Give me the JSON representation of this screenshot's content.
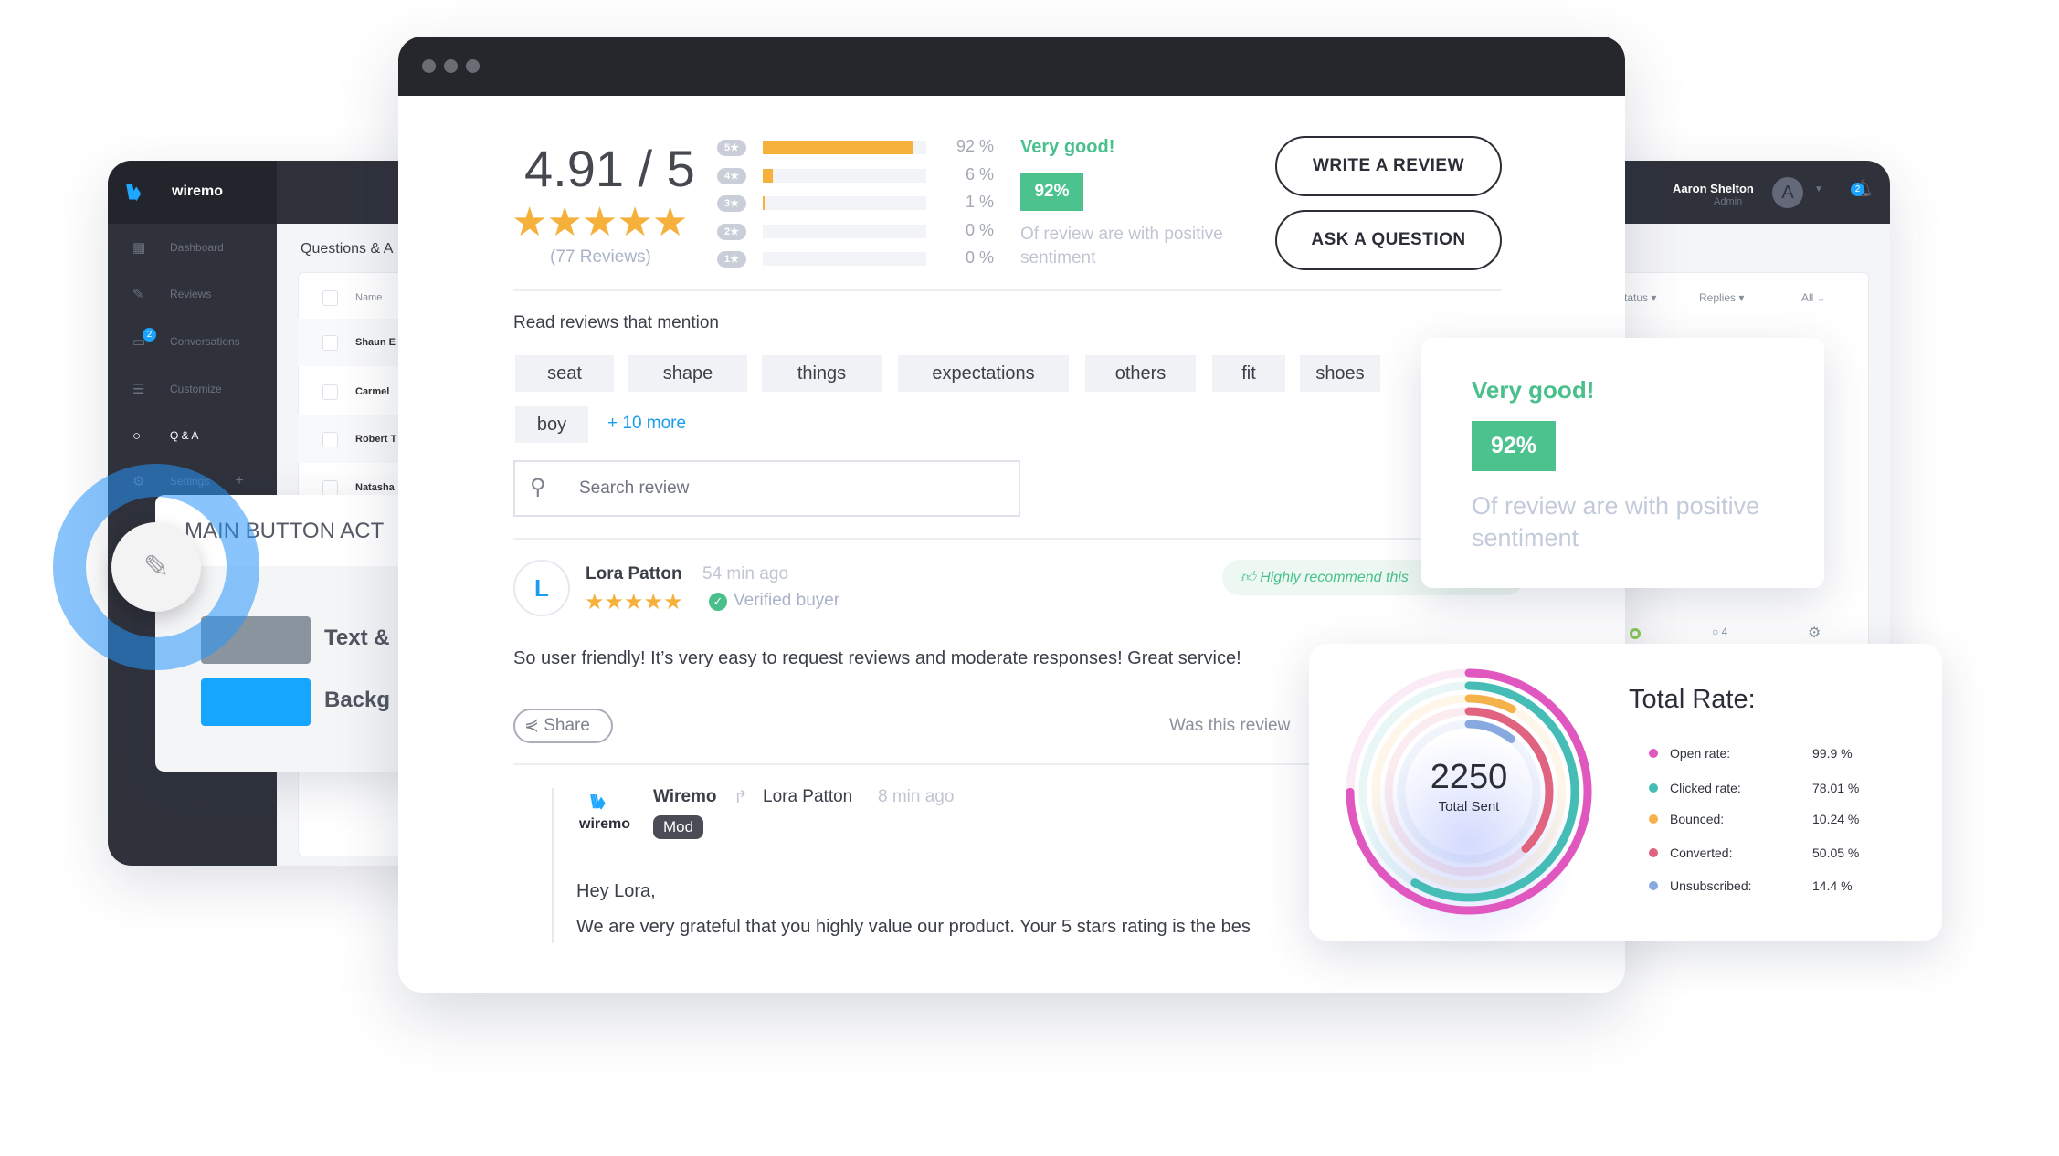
{
  "dashboard": {
    "brand": "wiremo",
    "sidebar": [
      {
        "label": "Dashboard",
        "icon": "grid-icon"
      },
      {
        "label": "Reviews",
        "icon": "edit-icon"
      },
      {
        "label": "Conversations",
        "icon": "chat-icon",
        "badge": "2"
      },
      {
        "label": "Customize",
        "icon": "sliders-icon"
      },
      {
        "label": "Q & A",
        "icon": "speech-bubble-icon"
      },
      {
        "label": "Settings",
        "icon": "gear-icon"
      }
    ],
    "settings_add": "+",
    "page_title": "Questions & A",
    "table": {
      "header": "Name",
      "rows": [
        "Shaun E",
        "Carmel",
        "Robert T",
        "Natasha"
      ]
    },
    "filters": [
      "tatus ▾",
      "Replies ▾",
      "All ⌄"
    ],
    "row_comment_count": "4",
    "user": {
      "name": "Aaron Shelton",
      "role": "Admin",
      "avatar": "A",
      "notifications": "2"
    }
  },
  "color_panel": {
    "title": "MAIN BUTTON ACT",
    "options": [
      {
        "label": "Text &",
        "color": "#8a949e"
      },
      {
        "label": "Backg",
        "color": "#17a6ff"
      }
    ]
  },
  "widget": {
    "rating": "4.91 / 5",
    "stars": 5,
    "review_count": "(77 Reviews)",
    "distribution": [
      {
        "stars": "5",
        "percent": 92,
        "label": "92 %"
      },
      {
        "stars": "4",
        "percent": 6,
        "label": "6 %"
      },
      {
        "stars": "3",
        "percent": 1,
        "label": "1 %"
      },
      {
        "stars": "2",
        "percent": 0,
        "label": "0 %"
      },
      {
        "stars": "1",
        "percent": 0,
        "label": "0 %"
      }
    ],
    "sentiment_title": "Very good!",
    "sentiment_percent": "92%",
    "sentiment_text": "Of review are with positive sentiment",
    "write_review": "WRITE A REVIEW",
    "ask_question": "ASK A QUESTION",
    "mention_title": "Read reviews that mention",
    "tags": [
      "seat",
      "shape",
      "things",
      "expectations",
      "others",
      "fit",
      "shoes",
      "boy"
    ],
    "more_tags": "+ 10 more",
    "search_placeholder": "Search review",
    "review": {
      "avatar": "L",
      "author": "Lora Patton",
      "time": "54 min ago",
      "verified": "Verified buyer",
      "recommend": "Highly recommend this",
      "text": "So user friendly! It’s very easy to request reviews and moderate responses! Great service!",
      "share": "Share",
      "helpful": "Was this review"
    },
    "reply": {
      "brand": "wiremo",
      "author": "Wiremo",
      "to": "Lora Patton",
      "time": "8 min ago",
      "badge": "Mod",
      "greeting": "Hey Lora,",
      "text": "We are very grateful that you highly value our product. Your 5 stars rating is the bes"
    }
  },
  "sentiment_card": {
    "title": "Very good!",
    "percent": "92%",
    "text": "Of review are with positive sentiment"
  },
  "chart_data": {
    "type": "radial-bar",
    "title": "Total Rate:",
    "center_value": "2250",
    "center_label": "Total Sent",
    "series": [
      {
        "name": "Open rate:",
        "value": 99.9,
        "label": "99.9 %",
        "color": "#e057bf"
      },
      {
        "name": "Clicked rate:",
        "value": 78.01,
        "label": "78.01 %",
        "color": "#45bdb6"
      },
      {
        "name": "Bounced:",
        "value": 10.24,
        "label": "10.24 %",
        "color": "#f5b14a"
      },
      {
        "name": "Converted:",
        "value": 50.05,
        "label": "50.05 %",
        "color": "#e0637f"
      },
      {
        "name": "Unsubscribed:",
        "value": 14.4,
        "label": "14.4 %",
        "color": "#88a9e0"
      }
    ]
  }
}
